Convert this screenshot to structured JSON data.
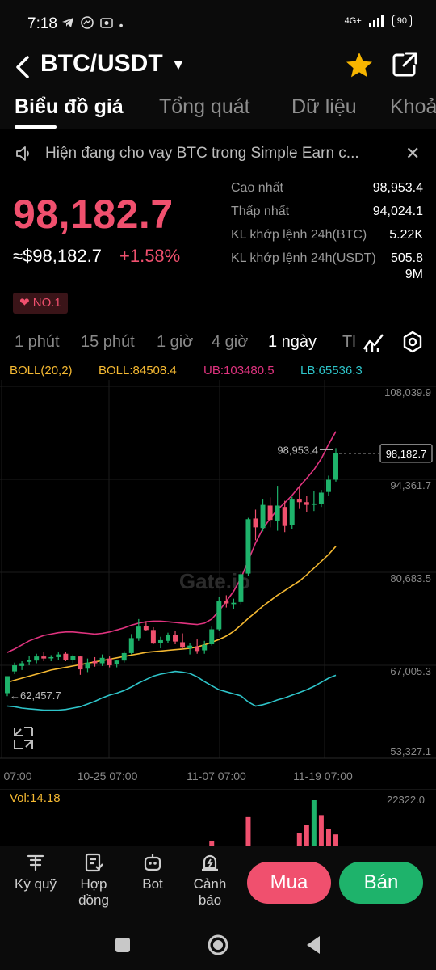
{
  "status_bar": {
    "time": "7:18",
    "left_icons": [
      "telegram-icon",
      "messenger-icon",
      "photo-icon",
      "more-dots-icon"
    ],
    "network": "4G+",
    "battery": "90"
  },
  "header": {
    "pair": "BTC/USDT",
    "favorite_icon": "star-icon",
    "share_icon": "share-icon"
  },
  "tabs": [
    {
      "label": "Biểu đồ giá",
      "active": true
    },
    {
      "label": "Tổng quát"
    },
    {
      "label": "Dữ liệu"
    },
    {
      "label": "Khoả"
    }
  ],
  "notice": {
    "text": "Hiện đang cho vay BTC trong Simple Earn c...",
    "icon": "speaker-icon",
    "close_icon": "close-icon"
  },
  "price": {
    "last": "98,182.7",
    "usd": "≈$98,182.7",
    "change": "+1.58%",
    "rank": "NO.1"
  },
  "stats": [
    {
      "label": "Cao nhất",
      "value": "98,953.4"
    },
    {
      "label": "Thấp nhất",
      "value": "94,024.1"
    },
    {
      "label": "KL khớp lệnh 24h(BTC)",
      "value": "5.22K"
    },
    {
      "label": "KL khớp lệnh 24h(USDT)",
      "value": "505.8",
      "value_cont": "9M"
    }
  ],
  "intervals": [
    {
      "label": "1 phút"
    },
    {
      "label": "15 phút"
    },
    {
      "label": "1 giờ"
    },
    {
      "label": "4 giờ"
    },
    {
      "label": "1 ngày",
      "active": true
    },
    {
      "label": "Tl"
    }
  ],
  "interval_icons": [
    "indicator-icon",
    "settings-icon"
  ],
  "boll": {
    "name": "BOLL(20,2)",
    "mid": "BOLL:84508.4",
    "ub": "UB:103480.5",
    "lb": "LB:65536.3"
  },
  "colors": {
    "up": "#1eb36b",
    "down": "#f0506e",
    "boll_mid": "#f5b932",
    "boll_ub": "#e0337f",
    "boll_lb": "#2ec4c9"
  },
  "watermark": "Gate.io",
  "chart_data": {
    "type": "candlestick",
    "y_ticks": [
      "108,039.9",
      "94,361.7",
      "80,683.5",
      "67,005.3",
      "53,327.1"
    ],
    "ylim": [
      53327.1,
      108039.9
    ],
    "x_ticks": [
      "07:00",
      "10-25 07:00",
      "11-07 07:00",
      "11-19 07:00"
    ],
    "current_price_label": "98,182.7",
    "high_annotation": "98,953.4",
    "low_annotation": "62,457.7",
    "candles": [
      {
        "o": 62900,
        "h": 64200,
        "l": 62458,
        "c": 65400
      },
      {
        "o": 66100,
        "h": 67400,
        "l": 65700,
        "c": 67000
      },
      {
        "o": 66900,
        "h": 67600,
        "l": 66300,
        "c": 67300
      },
      {
        "o": 67500,
        "h": 68400,
        "l": 67000,
        "c": 67800
      },
      {
        "o": 67700,
        "h": 68700,
        "l": 67300,
        "c": 68300
      },
      {
        "o": 68300,
        "h": 69000,
        "l": 67600,
        "c": 68000
      },
      {
        "o": 68100,
        "h": 68500,
        "l": 67600,
        "c": 68200
      },
      {
        "o": 68200,
        "h": 68900,
        "l": 67800,
        "c": 68600
      },
      {
        "o": 68700,
        "h": 69000,
        "l": 67600,
        "c": 67800
      },
      {
        "o": 67800,
        "h": 68600,
        "l": 67300,
        "c": 68400
      },
      {
        "o": 68300,
        "h": 68400,
        "l": 65600,
        "c": 66400
      },
      {
        "o": 66500,
        "h": 68000,
        "l": 66000,
        "c": 67400
      },
      {
        "o": 67600,
        "h": 68200,
        "l": 66800,
        "c": 67300
      },
      {
        "o": 67300,
        "h": 68600,
        "l": 66900,
        "c": 68100
      },
      {
        "o": 68000,
        "h": 68300,
        "l": 66700,
        "c": 67000
      },
      {
        "o": 67200,
        "h": 67800,
        "l": 66700,
        "c": 67700
      },
      {
        "o": 67700,
        "h": 69100,
        "l": 67400,
        "c": 68800
      },
      {
        "o": 68800,
        "h": 71600,
        "l": 68600,
        "c": 71000
      },
      {
        "o": 71000,
        "h": 73800,
        "l": 70600,
        "c": 72700
      },
      {
        "o": 72800,
        "h": 73500,
        "l": 72000,
        "c": 72200
      },
      {
        "o": 72200,
        "h": 72600,
        "l": 70100,
        "c": 70200
      },
      {
        "o": 70300,
        "h": 71200,
        "l": 69500,
        "c": 70700
      },
      {
        "o": 70600,
        "h": 71800,
        "l": 70300,
        "c": 71500
      },
      {
        "o": 71500,
        "h": 72100,
        "l": 70100,
        "c": 70500
      },
      {
        "o": 70400,
        "h": 71700,
        "l": 69400,
        "c": 69600
      },
      {
        "o": 69500,
        "h": 70300,
        "l": 68600,
        "c": 69900
      },
      {
        "o": 69800,
        "h": 70800,
        "l": 68700,
        "c": 69100
      },
      {
        "o": 69200,
        "h": 70600,
        "l": 68700,
        "c": 70000
      },
      {
        "o": 70100,
        "h": 72700,
        "l": 69900,
        "c": 72300
      },
      {
        "o": 72300,
        "h": 77000,
        "l": 72100,
        "c": 76400
      },
      {
        "o": 76500,
        "h": 77300,
        "l": 75500,
        "c": 76100
      },
      {
        "o": 76000,
        "h": 76800,
        "l": 75300,
        "c": 76200
      },
      {
        "o": 76300,
        "h": 80800,
        "l": 76000,
        "c": 80400
      },
      {
        "o": 80500,
        "h": 88700,
        "l": 80100,
        "c": 88500
      },
      {
        "o": 88600,
        "h": 89900,
        "l": 85400,
        "c": 87300
      },
      {
        "o": 87200,
        "h": 91500,
        "l": 86700,
        "c": 90600
      },
      {
        "o": 90500,
        "h": 91700,
        "l": 87300,
        "c": 88400
      },
      {
        "o": 88300,
        "h": 93400,
        "l": 86800,
        "c": 90500
      },
      {
        "o": 90300,
        "h": 91200,
        "l": 86600,
        "c": 87500
      },
      {
        "o": 87600,
        "h": 91800,
        "l": 87000,
        "c": 91500
      },
      {
        "o": 91500,
        "h": 93300,
        "l": 90000,
        "c": 91000
      },
      {
        "o": 91000,
        "h": 91900,
        "l": 89500,
        "c": 90600
      },
      {
        "o": 90600,
        "h": 92600,
        "l": 89700,
        "c": 90800
      },
      {
        "o": 90700,
        "h": 92800,
        "l": 90300,
        "c": 92400
      },
      {
        "o": 92500,
        "h": 94900,
        "l": 91900,
        "c": 94300
      },
      {
        "o": 94300,
        "h": 98953,
        "l": 94024,
        "c": 98182.7
      }
    ],
    "boll_ub": [
      68900,
      69400,
      70000,
      70600,
      71000,
      71400,
      71600,
      71800,
      71900,
      71900,
      71800,
      71700,
      71600,
      71700,
      71900,
      72200,
      72500,
      72900,
      73200,
      73400,
      73500,
      73500,
      73400,
      73300,
      73200,
      73100,
      73000,
      73200,
      73800,
      75000,
      76400,
      77900,
      79800,
      82400,
      85000,
      87100,
      88600,
      89900,
      90900,
      92000,
      93300,
      94500,
      95800,
      97400,
      99500,
      101400
    ],
    "boll_mid": [
      64500,
      64800,
      65100,
      65400,
      65700,
      66000,
      66300,
      66500,
      66700,
      66900,
      67100,
      67300,
      67500,
      67700,
      67900,
      68100,
      68300,
      68500,
      68700,
      68900,
      69000,
      69100,
      69200,
      69300,
      69400,
      69500,
      69700,
      70000,
      70400,
      70800,
      71300,
      72000,
      72900,
      73900,
      74800,
      75700,
      76500,
      77300,
      78000,
      78700,
      79400,
      80300,
      81300,
      82300,
      83300,
      84508
    ],
    "boll_lb": [
      61000,
      60900,
      60700,
      60600,
      60500,
      60400,
      60400,
      60400,
      60500,
      60700,
      60900,
      61300,
      61700,
      62200,
      62600,
      62900,
      63300,
      63800,
      64400,
      64900,
      65400,
      65700,
      65900,
      66100,
      66000,
      65800,
      65300,
      64600,
      64000,
      63400,
      63100,
      62800,
      62500,
      61600,
      61000,
      61200,
      61500,
      61900,
      62200,
      62600,
      63000,
      63400,
      63900,
      64500,
      65100,
      65536
    ]
  },
  "volume": {
    "label": "Vol:14.18",
    "max_label": "22322.0",
    "max": 22322,
    "bars": [
      {
        "idx": 28,
        "v": 2400,
        "up": false
      },
      {
        "idx": 33,
        "v": 14000,
        "up": false
      },
      {
        "idx": 40,
        "v": 6000,
        "up": false
      },
      {
        "idx": 41,
        "v": 10000,
        "up": false
      },
      {
        "idx": 42,
        "v": 22322,
        "up": true
      },
      {
        "idx": 43,
        "v": 15000,
        "up": false
      },
      {
        "idx": 44,
        "v": 8000,
        "up": false
      },
      {
        "idx": 45,
        "v": 5500,
        "up": false
      }
    ]
  },
  "bottom_nav": [
    {
      "label": "Ký quỹ",
      "icon": "margin-icon"
    },
    {
      "label": "Hợp đồng",
      "icon": "contract-icon"
    },
    {
      "label": "Bot",
      "icon": "bot-icon"
    },
    {
      "label": "Cảnh báo",
      "icon": "alarm-icon"
    }
  ],
  "actions": {
    "buy": "Mua",
    "sell": "Bán"
  },
  "system_nav": [
    "recents-icon",
    "home-icon",
    "back-icon"
  ]
}
